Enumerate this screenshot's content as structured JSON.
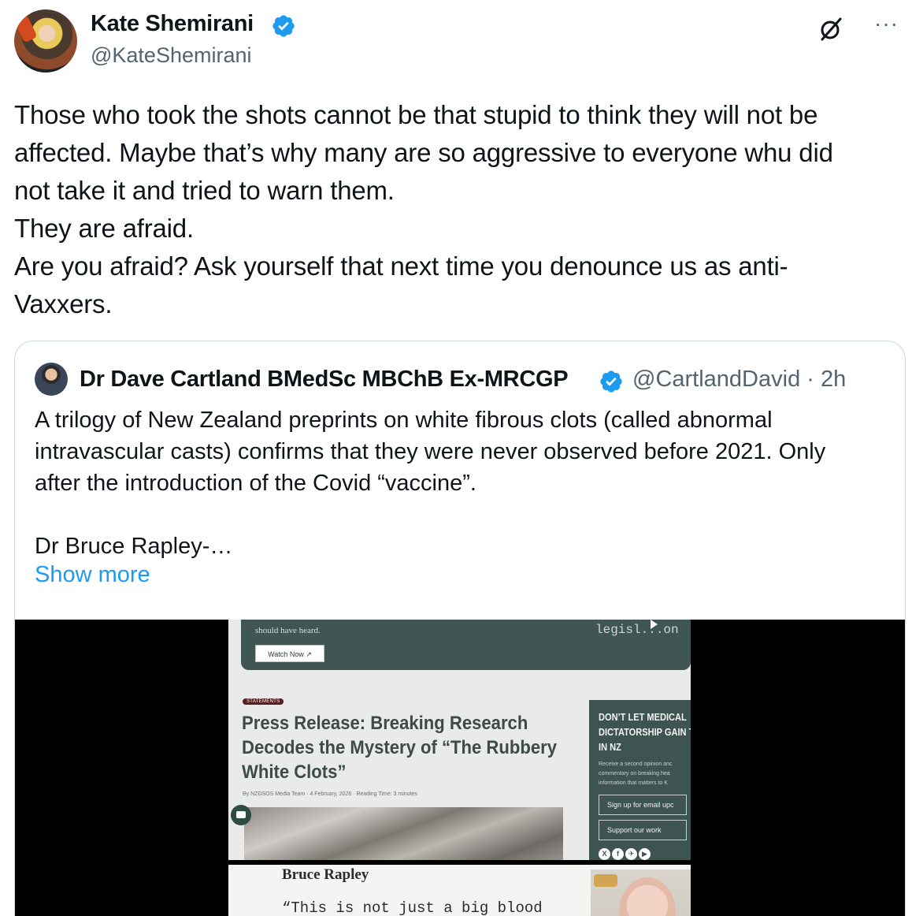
{
  "author": {
    "name": "Kate Shemirani",
    "handle": "@KateShemirani",
    "verified": true
  },
  "header_icons": [
    "grok-icon",
    "more-options-icon"
  ],
  "more_glyph": "···",
  "tweet_lines": [
    "Those who took the shots cannot be that stupid to think they will not be",
    "affected. Maybe that’s why many are  so aggressive to everyone whu did",
    "not take it and tried to warn them.",
    "They are afraid.",
    "Are you afraid? Ask yourself that next time you denounce us as anti-",
    "Vaxxers."
  ],
  "quoted": {
    "name": "Dr Dave Cartland BMedSc MBChB Ex-MRCGP",
    "handle_time": "@CartlandDavid · 2h",
    "verified": true,
    "text_lines": [
      "A trilogy of New Zealand preprints on white fibrous clots (called abnormal",
      "intravascular casts) confirms that they were never observed before 2021. Only",
      "after the introduction of the Covid “vaccine”.",
      "",
      "Dr Bruce Rapley-…"
    ],
    "show_more": "Show more",
    "media": {
      "banner_text": "should have heard.",
      "watch_button": "Watch Now ↗",
      "banner_right": "legisl...on",
      "tag": "STATEMENTS",
      "headline_lines": [
        "Press Release: Breaking Research",
        "Decodes the Mystery of “The Rubbery",
        "White Clots”"
      ],
      "byline": "By NZDSOS Media Team · 4 February, 2026 · Reading Time: 3 minutes",
      "sidebar_title_lines": [
        "DON’T LET MEDICAL",
        "DICTATORSHIP GAIN TR",
        "IN NZ"
      ],
      "sidebar_small_lines": [
        "Receive a second opinion anc",
        "commentary on breaking hea",
        "information that matters to K"
      ],
      "sidebar_button_1": "Sign up for email upc",
      "sidebar_button_2": "Support our work",
      "social_glyphs": [
        "X",
        "f",
        "✈",
        "▶"
      ],
      "lower_name": "Bruce Rapley",
      "lower_quote": "“This is not just a big blood"
    }
  },
  "colors": {
    "text": "#0f1419",
    "secondary": "#536471",
    "link": "#1d9bf0",
    "verified_badge": "#1d9bf0",
    "card_border": "#cfd9de",
    "site_green": "#3d5450"
  }
}
